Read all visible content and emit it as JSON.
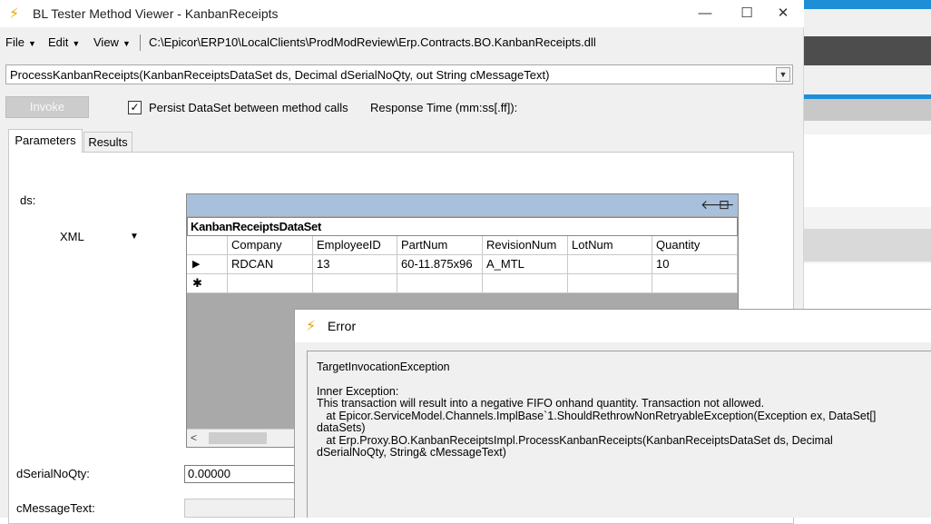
{
  "window": {
    "title": "BL Tester Method Viewer - KanbanReceipts",
    "minimize": "—",
    "maximize": "☐",
    "close": "✕"
  },
  "menu": {
    "file": "File",
    "edit": "Edit",
    "view": "View",
    "dll_path": "C:\\Epicor\\ERP10\\LocalClients\\ProdModReview\\Erp.Contracts.BO.KanbanReceipts.dll"
  },
  "method": {
    "selected": "ProcessKanbanReceipts(KanbanReceiptsDataSet ds, Decimal dSerialNoQty, out String cMessageText)"
  },
  "toolbar": {
    "invoke_label": "Invoke",
    "persist_label": "Persist DataSet between method calls",
    "persist_checked": true,
    "response_time_label": "Response Time (mm:ss[.ff]):"
  },
  "tabs": {
    "parameters": "Parameters",
    "results": "Results"
  },
  "params": {
    "ds_label": "ds:",
    "format": "XML",
    "serial_label": "dSerialNoQty:",
    "serial_value": "0.00000",
    "message_label": "cMessageText:"
  },
  "grid": {
    "caption": "KanbanReceiptsDataSet",
    "columns": [
      "Company",
      "EmployeeID",
      "PartNum",
      "RevisionNum",
      "LotNum",
      "Quantity"
    ],
    "rows": [
      [
        "RDCAN",
        "13",
        "60-11.875x96",
        "A_MTL",
        "",
        "10"
      ]
    ],
    "current_row_marker": "▶",
    "new_row_marker": "✱"
  },
  "error": {
    "title": "Error",
    "line1": "TargetInvocationException",
    "line2": "",
    "line3": "Inner Exception:",
    "line4": "This transaction will result into a negative FIFO onhand quantity. Transaction not allowed.",
    "line5": "   at Epicor.ServiceModel.Channels.ImplBase`1.ShouldRethrowNonRetryableException(Exception ex, DataSet[]",
    "line6": "dataSets)",
    "line7": "   at Erp.Proxy.BO.KanbanReceiptsImpl.ProcessKanbanReceipts(KanbanReceiptsDataSet ds, Decimal",
    "line8": "dSerialNoQty, String& cMessageText)"
  },
  "colors": {
    "grid_header": "#a8c0dc",
    "grid_background": "#a9a9a9",
    "icon_accent": "#e5a50a",
    "bg_app_blue": "#1e8fd6"
  }
}
